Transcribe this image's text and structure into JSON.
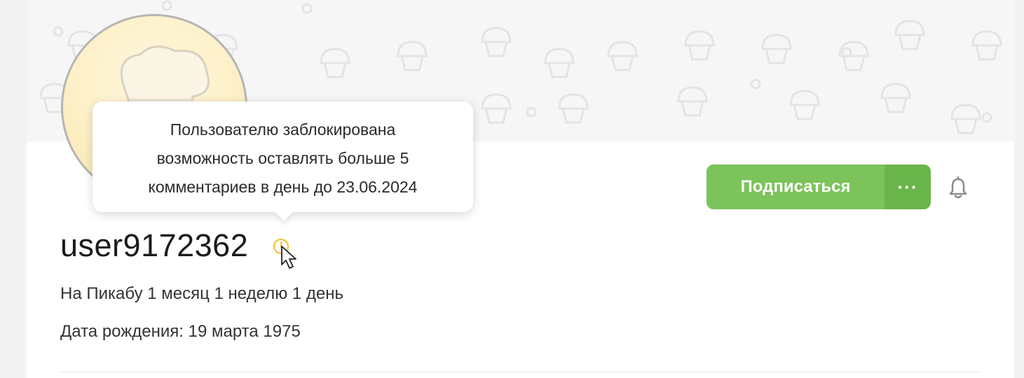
{
  "profile": {
    "username": "user9172362",
    "on_site": "На Пикабу 1 месяц 1 неделю 1 день",
    "birthday": "Дата рождения: 19 марта 1975",
    "status_icon": "clock-icon"
  },
  "actions": {
    "subscribe_label": "Подписаться",
    "more_label": "···",
    "bell_icon": "bell-icon"
  },
  "tooltip": {
    "lines": [
      "Пользователю заблокирована",
      "возможность оставлять больше 5",
      "комментариев в день до 23.06.2024"
    ]
  },
  "colors": {
    "subscribe_bg": "#7bc35a",
    "more_bg": "#6ab54a",
    "status_icon": "#f2c94c"
  }
}
